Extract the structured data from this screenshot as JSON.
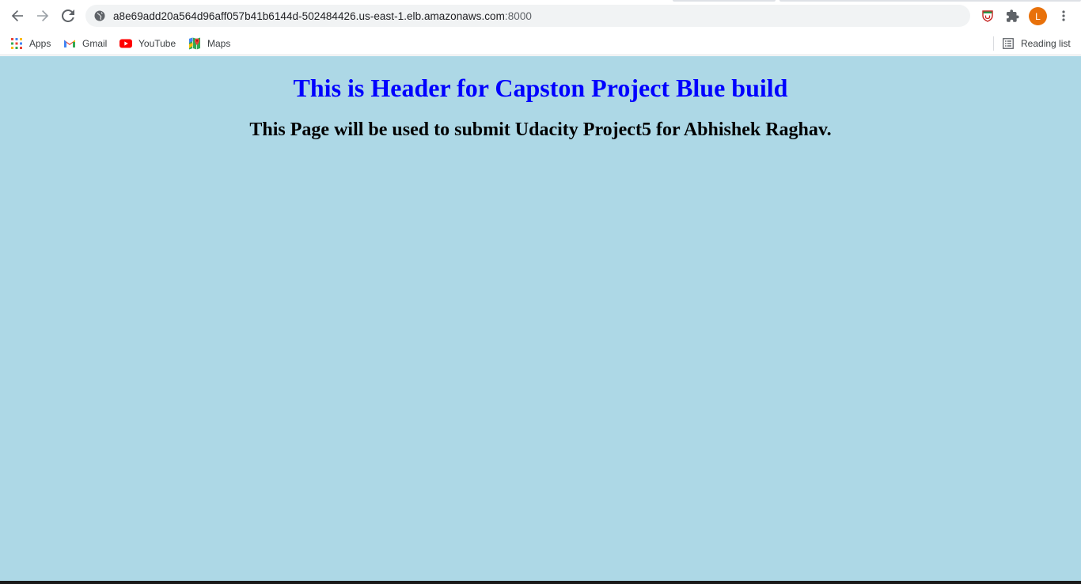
{
  "browser": {
    "url_main": "a8e69add20a564d96aff057b41b6144d-502484426.us-east-1.elb.amazonaws.com",
    "url_port": ":8000",
    "profile_initial": "L"
  },
  "bookmarks": {
    "apps": "Apps",
    "gmail": "Gmail",
    "youtube": "YouTube",
    "maps": "Maps",
    "reading_list": "Reading list"
  },
  "page": {
    "heading": "This is Header for Capston Project Blue build",
    "subheading": "This Page will be used to submit Udacity Project5 for Abhishek Raghav.",
    "background_color": "#add8e6",
    "heading_color": "#0000ff"
  },
  "icons": {
    "back": "arrow-left-icon",
    "forward": "arrow-right-icon",
    "reload": "reload-icon",
    "site_info": "globe-icon",
    "extension": "shield-extension-icon",
    "extensions_menu": "puzzle-icon",
    "menu": "three-dots-icon",
    "apps": "apps-grid-icon",
    "reading_list": "reading-list-icon"
  }
}
